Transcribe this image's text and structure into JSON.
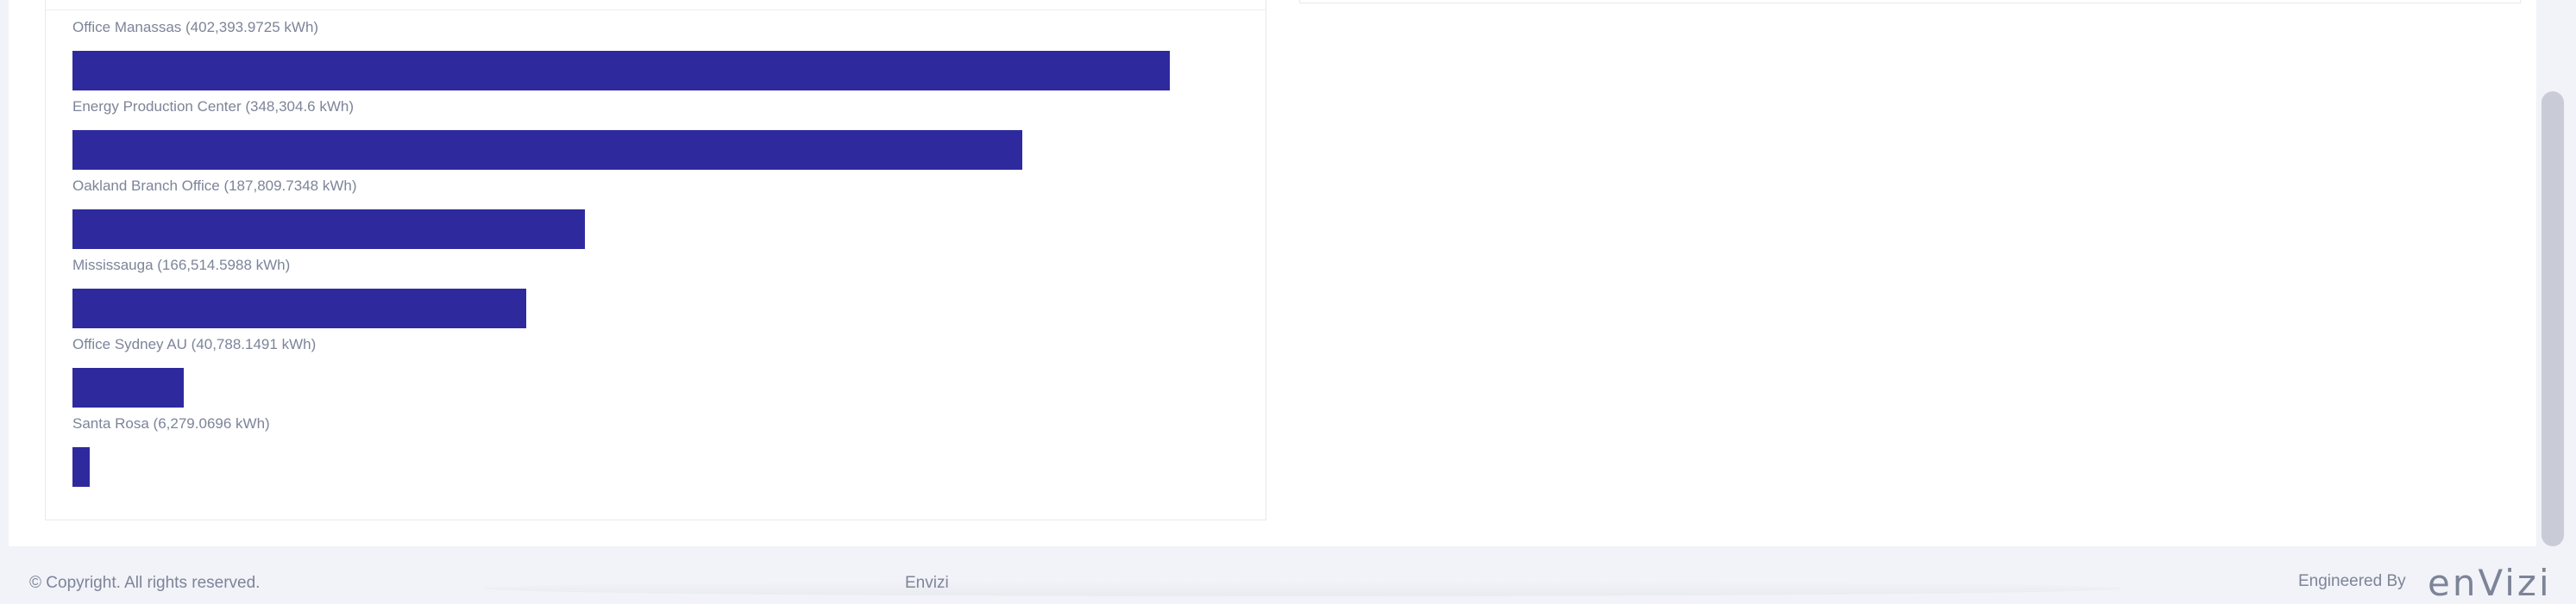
{
  "chart_data": {
    "type": "bar",
    "orientation": "horizontal",
    "categories": [
      "Office Manassas",
      "Energy Production Center",
      "Oakland Branch Office",
      "Mississauga",
      "Office Sydney AU",
      "Santa Rosa"
    ],
    "values": [
      402393.9725,
      348304.6,
      187809.7348,
      166514.5988,
      40788.1491,
      6279.0696
    ],
    "labels": [
      "Office Manassas (402,393.9725 kWh)",
      "Energy Production Center (348,304.6 kWh)",
      "Oakland Branch Office (187,809.7348 kWh)",
      "Mississauga (166,514.5988 kWh)",
      "Office Sydney AU (40,788.1491 kWh)",
      "Santa Rosa (6,279.0696 kWh)"
    ],
    "unit": "kWh",
    "bar_color": "#2e2a9e"
  },
  "footer": {
    "copyright": "© Copyright. All rights reserved.",
    "brand": "Envizi",
    "engineered_by": "Engineered By",
    "logo_text": "enVizi"
  }
}
